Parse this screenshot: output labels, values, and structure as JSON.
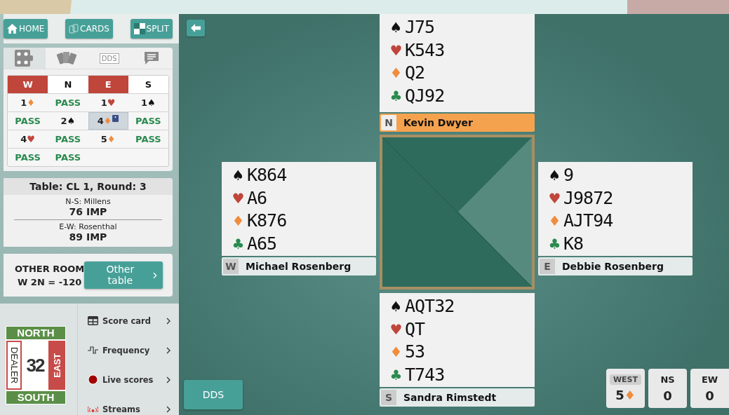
{
  "nav_buttons": [
    {
      "kind": "home",
      "label": "HOME"
    },
    {
      "kind": "cards",
      "label": "CARDS"
    },
    {
      "kind": "split",
      "label": "SPLIT"
    }
  ],
  "tabs": [
    {
      "kind": "diagram",
      "selected": true
    },
    {
      "kind": "hands",
      "selected": false
    },
    {
      "kind": "dds",
      "label": "DDS",
      "selected": false
    },
    {
      "kind": "chat",
      "selected": false
    }
  ],
  "bidding": {
    "seats": [
      {
        "label": "W",
        "vulnerable": true
      },
      {
        "label": "N",
        "vulnerable": false
      },
      {
        "label": "E",
        "vulnerable": true
      },
      {
        "label": "S",
        "vulnerable": false
      }
    ],
    "rows": [
      [
        {
          "text": "1",
          "suit": "♦",
          "kind": "diamond",
          "selected": false,
          "alert": false
        },
        {
          "text": "PASS",
          "kind": "pass",
          "selected": false,
          "alert": false
        },
        {
          "text": "1",
          "suit": "♥",
          "kind": "heart",
          "selected": false,
          "alert": false
        },
        {
          "text": "1",
          "suit": "♠",
          "kind": "spade",
          "selected": false,
          "alert": false
        }
      ],
      [
        {
          "text": "PASS",
          "kind": "pass",
          "selected": false,
          "alert": false
        },
        {
          "text": "2",
          "suit": "♠",
          "kind": "spade",
          "selected": false,
          "alert": false
        },
        {
          "text": "4",
          "suit": "♦",
          "kind": "diamond",
          "selected": true,
          "alert": true
        },
        {
          "text": "PASS",
          "kind": "pass",
          "selected": false,
          "alert": false
        }
      ],
      [
        {
          "text": "4",
          "suit": "♥",
          "kind": "heart",
          "selected": false,
          "alert": false
        },
        {
          "text": "PASS",
          "kind": "pass",
          "selected": false,
          "alert": false
        },
        {
          "text": "5",
          "suit": "♦",
          "kind": "diamond",
          "selected": false,
          "alert": false
        },
        {
          "text": "PASS",
          "kind": "pass",
          "selected": false,
          "alert": false
        }
      ],
      [
        {
          "text": "PASS",
          "kind": "pass",
          "selected": false,
          "alert": false
        },
        {
          "text": "PASS",
          "kind": "pass",
          "selected": false,
          "alert": false
        }
      ]
    ]
  },
  "table_info": {
    "title": "Table: CL 1, Round: 3",
    "teams": [
      {
        "name": "N-S: Millens",
        "score": "76 IMP"
      },
      {
        "name": "E-W: Rosenthal",
        "score": "89 IMP"
      }
    ]
  },
  "other_room": {
    "label": "OTHER ROOM",
    "result": "W 2N = -120",
    "button": "Other table"
  },
  "board": {
    "number": "32",
    "north": {
      "label": "NORTH",
      "vulnerable": false
    },
    "east": {
      "label": "EAST",
      "vulnerable": true
    },
    "south": {
      "label": "SOUTH",
      "vulnerable": false
    },
    "west": {
      "label": "DEALER",
      "dealer": true
    }
  },
  "menu": [
    {
      "kind": "scorecard",
      "label": "Score card"
    },
    {
      "kind": "frequency",
      "label": "Frequency"
    },
    {
      "kind": "live",
      "label": "Live scores"
    },
    {
      "kind": "streams",
      "label": "Streams"
    }
  ],
  "hands": {
    "north": {
      "seat": "N",
      "player": "Kevin Dwyer",
      "active": true,
      "suits": [
        {
          "symbol": "♠",
          "kind": "spade",
          "cards": "J75"
        },
        {
          "symbol": "♥",
          "kind": "heart",
          "cards": "K543"
        },
        {
          "symbol": "♦",
          "kind": "diamond",
          "cards": "Q2"
        },
        {
          "symbol": "♣",
          "kind": "club",
          "cards": "QJ92"
        }
      ]
    },
    "west": {
      "seat": "W",
      "player": "Michael Rosenberg",
      "active": false,
      "suits": [
        {
          "symbol": "♠",
          "kind": "spade",
          "cards": "K864"
        },
        {
          "symbol": "♥",
          "kind": "heart",
          "cards": "A6"
        },
        {
          "symbol": "♦",
          "kind": "diamond",
          "cards": "K876"
        },
        {
          "symbol": "♣",
          "kind": "club",
          "cards": "A65"
        }
      ]
    },
    "east": {
      "seat": "E",
      "player": "Debbie Rosenberg",
      "active": false,
      "suits": [
        {
          "symbol": "♠",
          "kind": "spade",
          "cards": "9"
        },
        {
          "symbol": "♥",
          "kind": "heart",
          "cards": "J9872"
        },
        {
          "symbol": "♦",
          "kind": "diamond",
          "cards": "AJT94"
        },
        {
          "symbol": "♣",
          "kind": "club",
          "cards": "K8"
        }
      ]
    },
    "south": {
      "seat": "S",
      "player": "Sandra Rimstedt",
      "active": false,
      "suits": [
        {
          "symbol": "♠",
          "kind": "spade",
          "cards": "AQT32"
        },
        {
          "symbol": "♥",
          "kind": "heart",
          "cards": "QT"
        },
        {
          "symbol": "♦",
          "kind": "diamond",
          "cards": "53"
        },
        {
          "symbol": "♣",
          "kind": "club",
          "cards": "T743"
        }
      ]
    }
  },
  "dds_button": "DDS",
  "scores": [
    {
      "kind": "contract",
      "label": "WEST",
      "value": "5",
      "suit": {
        "symbol": "♦",
        "kind": "diamond"
      }
    },
    {
      "kind": "tricks",
      "label": "NS",
      "value": "0"
    },
    {
      "kind": "tricks",
      "label": "EW",
      "value": "0"
    }
  ]
}
